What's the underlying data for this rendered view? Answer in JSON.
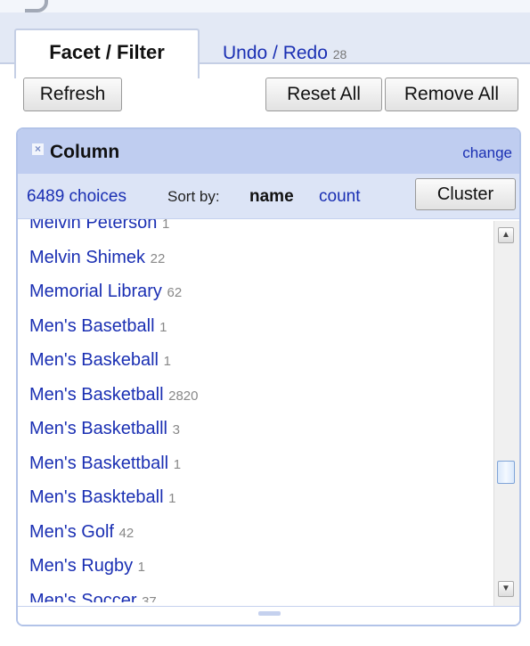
{
  "tabs": [
    {
      "label": "Facet / Filter"
    },
    {
      "label": "Undo / Redo",
      "count": "28"
    }
  ],
  "toolbar": {
    "refresh_label": "Refresh",
    "reset_all_label": "Reset All",
    "remove_all_label": "Remove All"
  },
  "facet": {
    "remove_icon": "×",
    "title": "Column",
    "change_label": "change",
    "choices_count": "6489 choices",
    "sort_by_label": "Sort by:",
    "sort_name_label": "name",
    "sort_count_label": "count",
    "cluster_label": "Cluster",
    "choices": [
      {
        "name": "Melvin Peterson",
        "count": "1"
      },
      {
        "name": "Melvin Shimek",
        "count": "22"
      },
      {
        "name": "Memorial Library",
        "count": "62"
      },
      {
        "name": "Men's Basetball",
        "count": "1"
      },
      {
        "name": "Men's Baskeball",
        "count": "1"
      },
      {
        "name": "Men's Basketball",
        "count": "2820"
      },
      {
        "name": "Men's Basketballl",
        "count": "3"
      },
      {
        "name": "Men's Baskettball",
        "count": "1"
      },
      {
        "name": "Men's Baskteball",
        "count": "1"
      },
      {
        "name": "Men's Golf",
        "count": "42"
      },
      {
        "name": "Men's Rugby",
        "count": "1"
      },
      {
        "name": "Men's Soccer",
        "count": "37"
      }
    ]
  },
  "scrollbar": {
    "up_glyph": "▲",
    "down_glyph": "▼"
  },
  "colors": {
    "link": "#1a2fb3",
    "facet_header": "#bfcdf0",
    "facet_controls": "#dce4f6",
    "tabbar": "#e3e9f5"
  }
}
